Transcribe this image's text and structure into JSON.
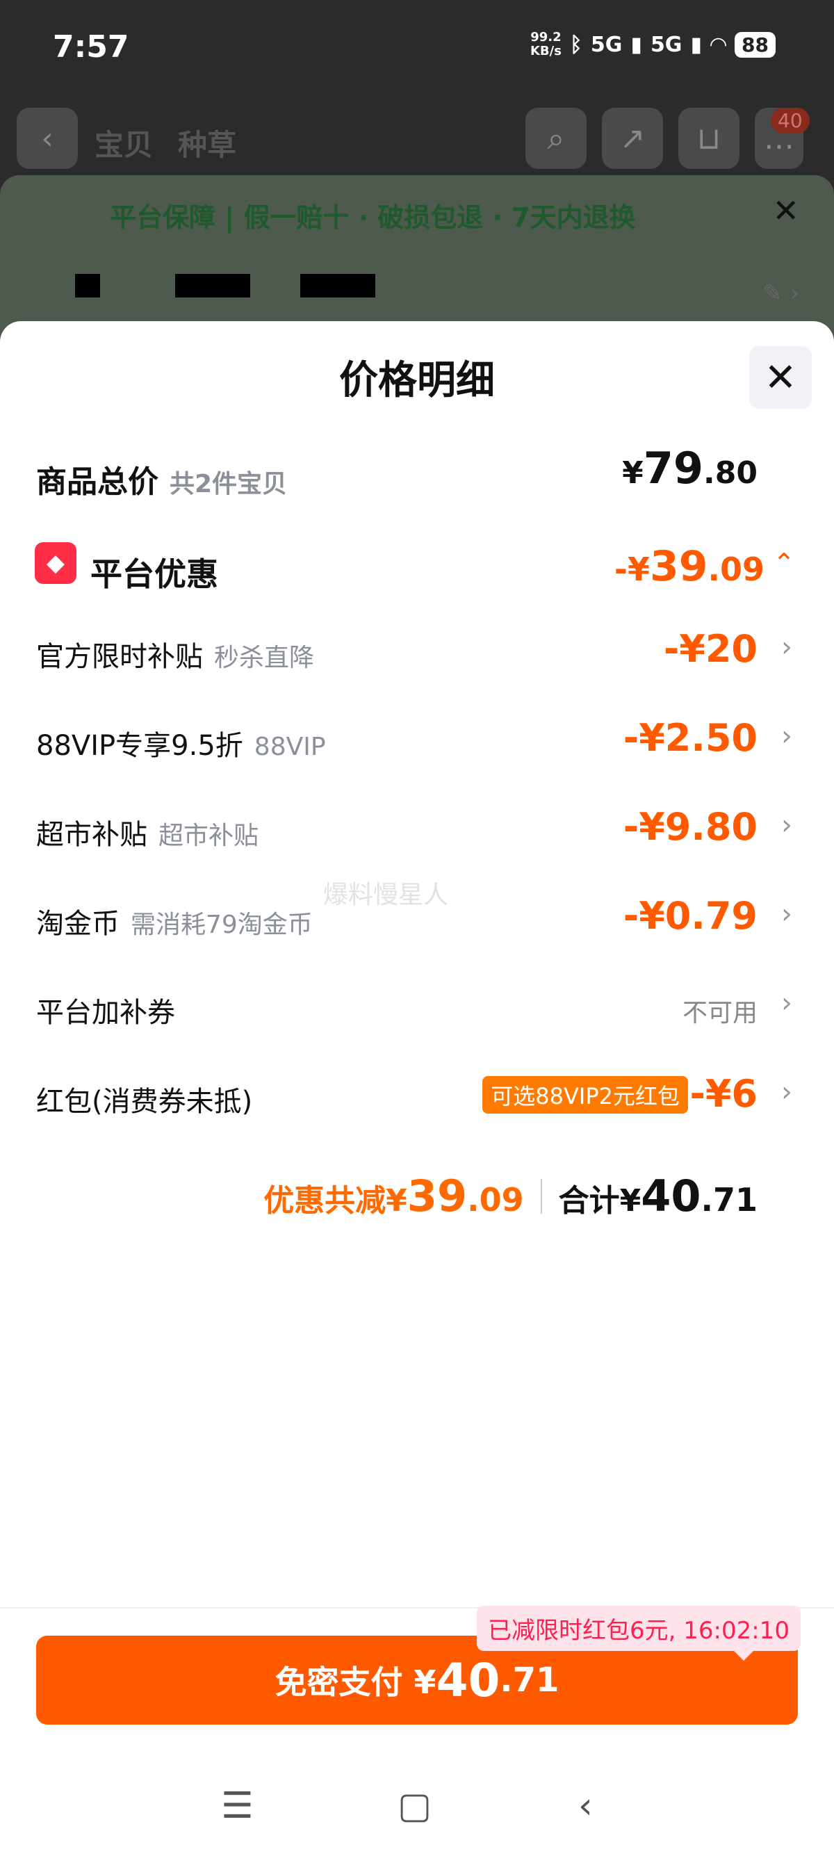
{
  "status_bar": {
    "time": "7:57",
    "net_speed_top": "99.2",
    "net_speed_bottom": "KB/s",
    "signal1": "5G",
    "signal2": "5G",
    "battery": "88"
  },
  "bg_nav": {
    "tab1": "宝贝",
    "tab2": "种草",
    "cart_badge": "40"
  },
  "guarantee": {
    "text": "平台保障 | 假一赔十 · 破损包退 · 7天内退换"
  },
  "sheet": {
    "title": "价格明细",
    "total": {
      "label": "商品总价",
      "sub": "共2件宝贝",
      "currency": "¥",
      "int": "79",
      "dec": ".80"
    },
    "promo": {
      "label": "平台优惠",
      "amount_prefix": "-¥",
      "int": "39",
      "dec": ".09"
    },
    "items": [
      {
        "label": "官方限时补贴",
        "sub": "秒杀直降",
        "amount": "-¥20"
      },
      {
        "label": "88VIP专享9.5折",
        "sub": "88VIP",
        "amount": "-¥2.50"
      },
      {
        "label": "超市补贴",
        "sub": "超市补贴",
        "amount": "-¥9.80"
      },
      {
        "label": "淘金币",
        "sub": "需消耗79淘金币",
        "amount": "-¥0.79"
      }
    ],
    "coupon": {
      "label": "平台加补券",
      "status": "不可用"
    },
    "redpacket": {
      "label": "红包(消费券未抵)",
      "tag": "可选88VIP2元红包",
      "amount": "-¥6"
    },
    "summary": {
      "disc_label": "优惠共减¥",
      "disc_int": "39",
      "disc_dec": ".09",
      "total_label": "合计¥",
      "total_int": "40",
      "total_dec": ".71"
    },
    "watermark": "爆料慢星人"
  },
  "footer": {
    "tip": "已减限时红包6元, 16:02:10",
    "pay_label": "免密支付 ¥",
    "pay_int": "40",
    "pay_dec": ".71"
  },
  "icons": {
    "promo": "tag-icon",
    "close": "close-icon",
    "chevron": "chevron-right-icon"
  }
}
